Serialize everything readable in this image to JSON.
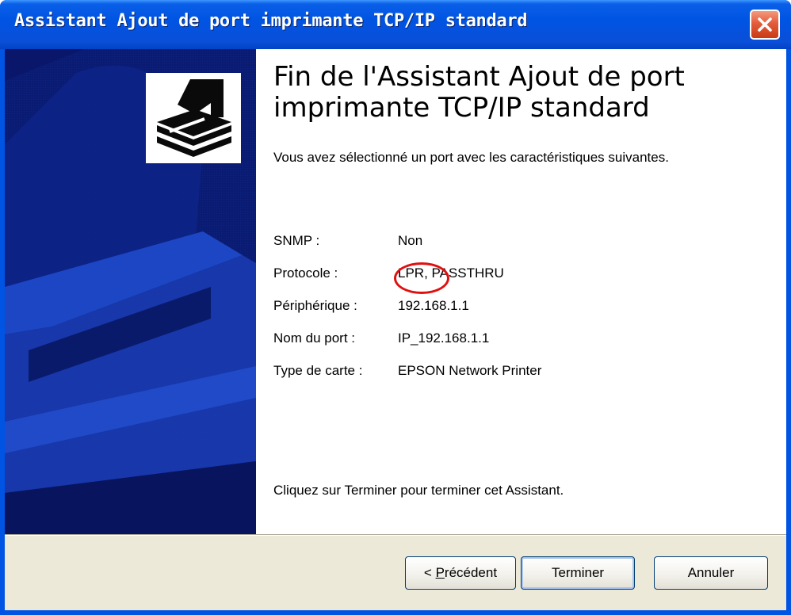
{
  "window": {
    "title": "Assistant Ajout de port imprimante TCP/IP standard"
  },
  "main": {
    "heading": "Fin de l'Assistant Ajout de port imprimante TCP/IP standard",
    "intro": "Vous avez sélectionné un port avec les caractéristiques suivantes.",
    "details": [
      {
        "label": "SNMP :",
        "value": "Non"
      },
      {
        "label": "Protocole :",
        "value": "LPR, PASSTHRU"
      },
      {
        "label": "Périphérique :",
        "value": "192.168.1.1"
      },
      {
        "label": "Nom du port :",
        "value": "IP_192.168.1.1"
      },
      {
        "label": "Type de carte :",
        "value": "EPSON Network Printer"
      }
    ],
    "finish_text": "Cliquez sur Terminer pour terminer cet Assistant."
  },
  "buttons": {
    "back_prefix": "< ",
    "back_mnemonic": "P",
    "back_rest": "récédent",
    "finish": "Terminer",
    "cancel": "Annuler"
  },
  "colors": {
    "titlebar": "#0054e3",
    "banner": "#0a1a6b",
    "highlight": "#e01010",
    "dialog_face": "#ece9d8"
  },
  "icons": {
    "close": "close-icon",
    "wizard": "printer-port-icon"
  }
}
